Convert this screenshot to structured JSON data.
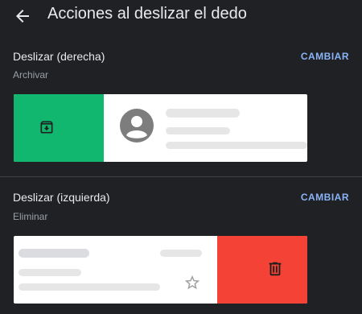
{
  "header": {
    "title": "Acciones al deslizar el dedo"
  },
  "right_swipe": {
    "title": "Deslizar (derecha)",
    "action": "Archivar",
    "change_label": "CAMBIAR",
    "action_color": "#12b76f"
  },
  "left_swipe": {
    "title": "Deslizar (izquierda)",
    "action": "Eliminar",
    "change_label": "CAMBIAR",
    "action_color": "#f44336"
  },
  "icons": {
    "back": "arrow-back-icon",
    "archive": "archive-icon",
    "avatar": "account-circle-icon",
    "star": "star-outline-icon",
    "delete": "trash-icon"
  },
  "colors": {
    "background": "#202124",
    "accent": "#8ab4f8",
    "card": "#ffffff"
  }
}
